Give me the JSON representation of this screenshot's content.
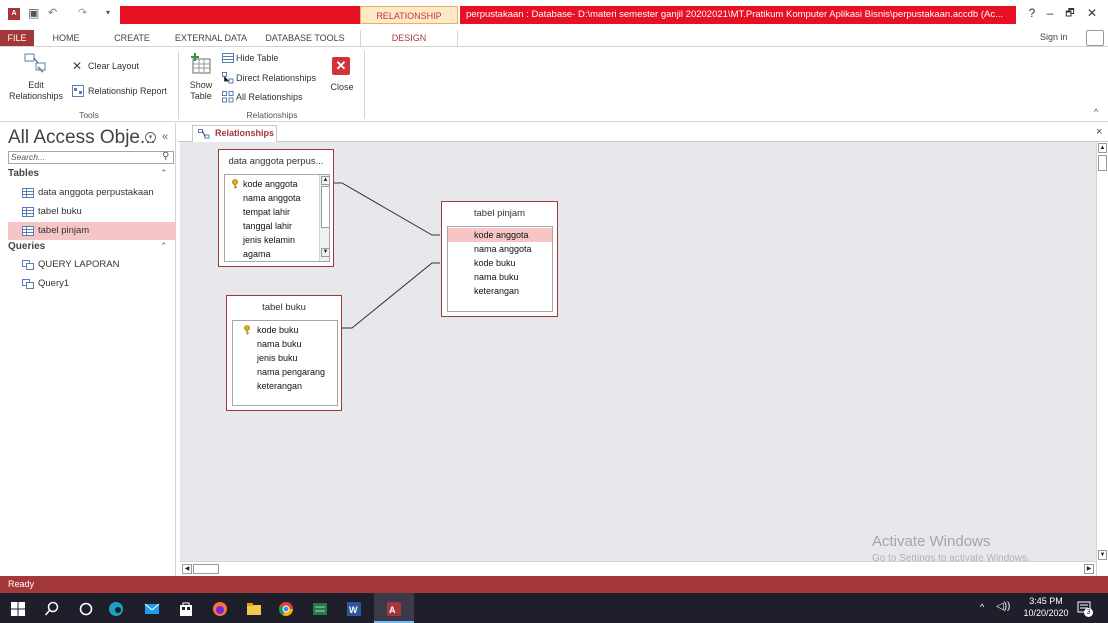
{
  "titlebar": {
    "contextual_tab": "RELATIONSHIP TOOLS",
    "title": "perpustakaan : Database- D:\\materi semester ganjil 20202021\\MT.Pratikum Komputer Aplikasi Bisnis\\perpustakaan.accdb (Ac...",
    "help": "?",
    "minimize": "–",
    "restore": "🗗",
    "close": "✕",
    "sign_in": "Sign in"
  },
  "tabs": [
    "FILE",
    "HOME",
    "CREATE",
    "EXTERNAL DATA",
    "DATABASE TOOLS",
    "DESIGN"
  ],
  "ribbon": {
    "edit_relationships": [
      "Edit",
      "Relationships"
    ],
    "clear_layout": "Clear Layout",
    "relationship_report": "Relationship Report",
    "tools_group": "Tools",
    "show_table": [
      "Show",
      "Table"
    ],
    "hide_table": "Hide Table",
    "direct_relationships": "Direct Relationships",
    "all_relationships": "All Relationships",
    "close": "Close",
    "relationships_group": "Relationships",
    "collapse": "^"
  },
  "nav": {
    "header": "All Access Obje...",
    "search_placeholder": "Search...",
    "tables_section": "Tables",
    "tables": [
      "data anggota perpustakaan",
      "tabel buku",
      "tabel pinjam"
    ],
    "selected_table": "tabel pinjam",
    "queries_section": "Queries",
    "queries": [
      "QUERY LAPORAN",
      "Query1"
    ]
  },
  "document": {
    "tab_label": "Relationships",
    "close": "×"
  },
  "diagram": {
    "tables": [
      {
        "name": "data anggota perpus...",
        "fields": [
          "kode anggota",
          "nama anggota",
          "tempat lahir",
          "tanggal lahir",
          "jenis kelamin",
          "agama"
        ],
        "key_field": "kode anggota"
      },
      {
        "name": "tabel pinjam",
        "fields": [
          "kode anggota",
          "nama anggota",
          "kode buku",
          "nama buku",
          "keterangan"
        ],
        "highlighted_field": "kode anggota"
      },
      {
        "name": "tabel buku",
        "fields": [
          "kode buku",
          "nama buku",
          "jenis buku",
          "nama pengarang",
          "keterangan"
        ],
        "key_field": "kode buku"
      }
    ]
  },
  "watermark": {
    "line1": "Activate Windows",
    "line2": "Go to Settings to activate Windows."
  },
  "status": "Ready",
  "taskbar": {
    "time": "3:45 PM",
    "date": "10/20/2020",
    "notification_count": "3"
  }
}
